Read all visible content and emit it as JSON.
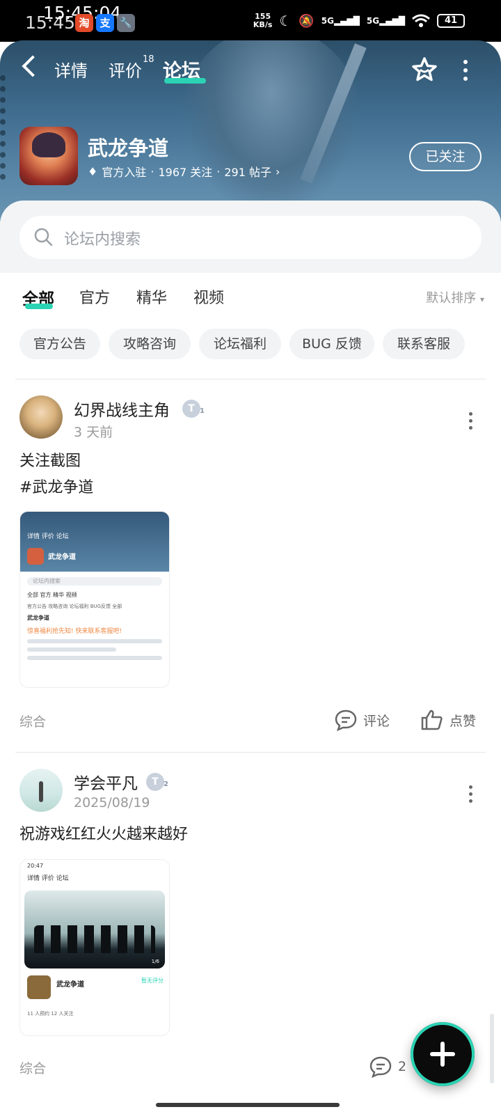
{
  "status_bar": {
    "time": "15:45",
    "time_overlay": "15:45:04",
    "net_speed": "155",
    "net_unit": "KB/s",
    "signal_1": "5G",
    "signal_2": "5G",
    "battery": "41",
    "app_icons": [
      "淘",
      "支"
    ]
  },
  "nav": {
    "tabs": [
      {
        "label": "详情"
      },
      {
        "label": "评价",
        "badge": "18"
      },
      {
        "label": "论坛"
      }
    ]
  },
  "game": {
    "title": "武龙争道",
    "official": "官方入驻",
    "followers": "1967 关注",
    "posts": "291 帖子",
    "follow_label": "已关注"
  },
  "search": {
    "placeholder": "论坛内搜索"
  },
  "filters": {
    "tabs": [
      "全部",
      "官方",
      "精华",
      "视频"
    ],
    "sort": "默认排序"
  },
  "chips": [
    "官方公告",
    "攻略咨询",
    "论坛福利",
    "BUG 反馈",
    "联系客服"
  ],
  "posts": [
    {
      "author": "幻界战线主角",
      "level": "1",
      "time": "3 天前",
      "lines": [
        "关注截图",
        "#武龙争道"
      ],
      "category": "综合",
      "comment_label": "评论",
      "like_label": "点赞",
      "thumb": {
        "tabs": [
          "详情",
          "评价",
          "论坛"
        ],
        "game": "武龙争道",
        "search": "论坛内搜索",
        "filters": [
          "全部",
          "官方",
          "精华",
          "视频"
        ],
        "chips": [
          "官方公告",
          "攻略咨询",
          "论坛福利",
          "BUG反馈",
          "全部"
        ],
        "headline": "惊喜福利抢先知! 快来联系客服吧!"
      }
    },
    {
      "author": "学会平凡",
      "level": "2",
      "time": "2025/08/19",
      "lines": [
        "祝游戏红红火火越来越好"
      ],
      "category": "综合",
      "comment_count": "2",
      "thumb": {
        "time": "20:47",
        "tabs": [
          "详情",
          "评价",
          "论坛"
        ],
        "game": "武龙争道",
        "rating": "暂无评分",
        "stats": "11 人预约  12 人关注",
        "page": "1/6"
      }
    }
  ],
  "colors": {
    "accent": "#2bd3b4",
    "header": "#406d8f"
  }
}
